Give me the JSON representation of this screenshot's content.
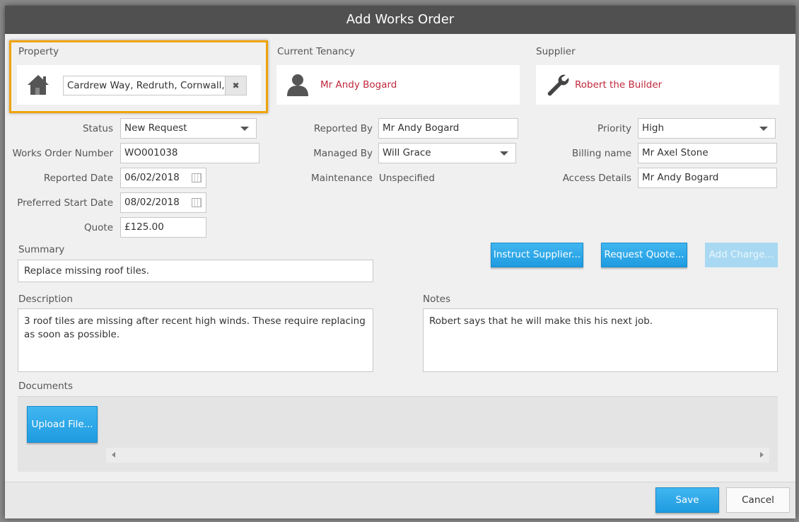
{
  "dialog": {
    "title": "Add Works Order"
  },
  "property": {
    "label": "Property",
    "value": "Cardrew Way, Redruth, Cornwall, T...",
    "clear_glyph": "✖",
    "icon": "house-icon",
    "highlight_color": "#f0a30a"
  },
  "tenancy": {
    "label": "Current Tenancy",
    "name": "Mr Andy Bogard",
    "icon": "person-icon"
  },
  "supplier": {
    "label": "Supplier",
    "name": "Robert the Builder",
    "icon": "wrench-icon"
  },
  "fields": {
    "status": {
      "label": "Status",
      "value": "New Request"
    },
    "works_order_number": {
      "label": "Works Order Number",
      "value": "WO001038"
    },
    "reported_date": {
      "label": "Reported Date",
      "value": "06/02/2018"
    },
    "preferred_start_date": {
      "label": "Preferred Start Date",
      "value": "08/02/2018"
    },
    "quote": {
      "label": "Quote",
      "value": "£125.00"
    },
    "reported_by": {
      "label": "Reported By",
      "value": "Mr Andy Bogard"
    },
    "managed_by": {
      "label": "Managed By",
      "value": "Will Grace"
    },
    "maintenance": {
      "label": "Maintenance",
      "value": "Unspecified"
    },
    "priority": {
      "label": "Priority",
      "value": "High"
    },
    "billing_name": {
      "label": "Billing name",
      "value": "Mr Axel Stone"
    },
    "access_details": {
      "label": "Access Details",
      "value": "Mr Andy Bogard"
    }
  },
  "summary": {
    "label": "Summary",
    "value": "Replace missing roof tiles."
  },
  "actions": {
    "instruct_supplier": "Instruct Supplier...",
    "request_quote": "Request Quote...",
    "add_charge": "Add Charge..."
  },
  "description": {
    "label": "Description",
    "value": "3 roof tiles are missing after recent high winds. These require replacing as soon as possible."
  },
  "notes": {
    "label": "Notes",
    "value": "Robert says that he will make this his next job."
  },
  "documents": {
    "label": "Documents",
    "upload_label": "Upload File..."
  },
  "footer": {
    "save_label": "Save",
    "cancel_label": "Cancel"
  },
  "colors": {
    "accent": "#1e9be0",
    "link_red": "#c0283c",
    "titlebar": "#505050"
  }
}
